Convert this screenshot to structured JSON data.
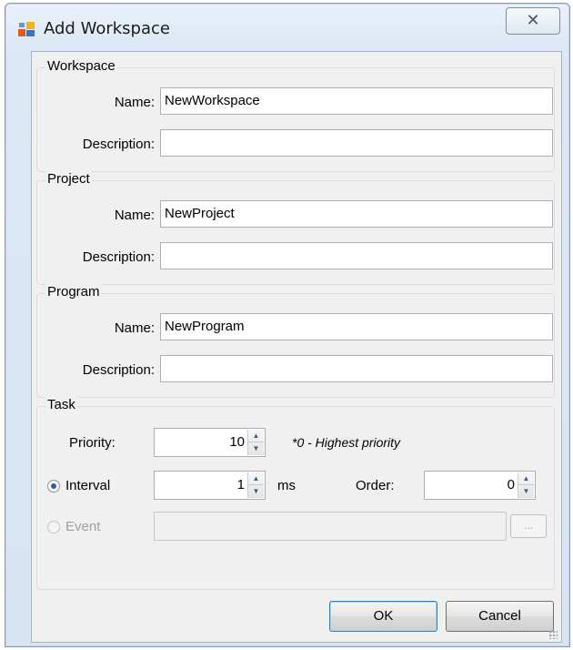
{
  "window": {
    "title": "Add Workspace",
    "close_glyph": "✕"
  },
  "workspace": {
    "legend": "Workspace",
    "name_label": "Name:",
    "name_value": "NewWorkspace",
    "description_label": "Description:",
    "description_value": ""
  },
  "project": {
    "legend": "Project",
    "name_label": "Name:",
    "name_value": "NewProject",
    "description_label": "Description:",
    "description_value": ""
  },
  "program": {
    "legend": "Program",
    "name_label": "Name:",
    "name_value": "NewProgram",
    "description_label": "Description:",
    "description_value": ""
  },
  "task": {
    "legend": "Task",
    "priority_label": "Priority:",
    "priority_value": "10",
    "priority_note": "*0 - Highest priority",
    "interval_label": "Interval",
    "interval_value": "1",
    "interval_unit": "ms",
    "order_label": "Order:",
    "order_value": "0",
    "event_label": "Event",
    "event_value": "",
    "browse_label": "..."
  },
  "buttons": {
    "ok": "OK",
    "cancel": "Cancel"
  },
  "colors": {
    "accent": "#3c7fb1",
    "radio_checked": "#2a5db0"
  }
}
